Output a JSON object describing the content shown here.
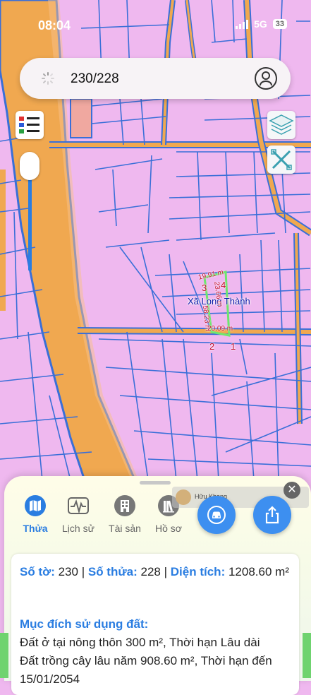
{
  "status_bar": {
    "time": "08:04",
    "network": "5G",
    "battery": "33"
  },
  "search": {
    "value": "230/228",
    "placeholder": ""
  },
  "map": {
    "commune_label": "Xã Long Thành",
    "corner_labels": [
      "3",
      "4",
      "2",
      "1"
    ],
    "dimension_labels": [
      "19.91 m",
      "23.66 m",
      "58.23 m",
      "20.09 m"
    ]
  },
  "tabs": [
    {
      "label": "Thửa",
      "icon": "map-icon",
      "active": true
    },
    {
      "label": "Lịch sử",
      "icon": "activity-icon",
      "active": false
    },
    {
      "label": "Tài sản",
      "icon": "building-icon",
      "active": false
    },
    {
      "label": "Hồ sơ",
      "icon": "books-icon",
      "active": false
    }
  ],
  "video_overlay": {
    "name": "Hữu Khang",
    "close": "✕"
  },
  "parcel": {
    "sheet_label": "Số tờ:",
    "sheet_value": "230",
    "parcel_label": "Số thửa:",
    "parcel_value": "228",
    "area_label": "Diện tích:",
    "area_value": "1208.60",
    "area_unit": "m²",
    "separator": "|",
    "purpose_label": "Mục đích sử dụng đất:",
    "purpose_lines": [
      "Đất ở tại nông thôn 300 m², Thời hạn Lâu dài",
      "Đất trồng cây lâu năm 908.60 m², Thời hạn đến",
      "15/01/2054"
    ]
  },
  "colors": {
    "land": "#efb8ef",
    "road": "#f0a850",
    "boundary": "#3a6fd8",
    "accent": "#2a7de1",
    "parcel_highlight": "#6ee66e"
  }
}
